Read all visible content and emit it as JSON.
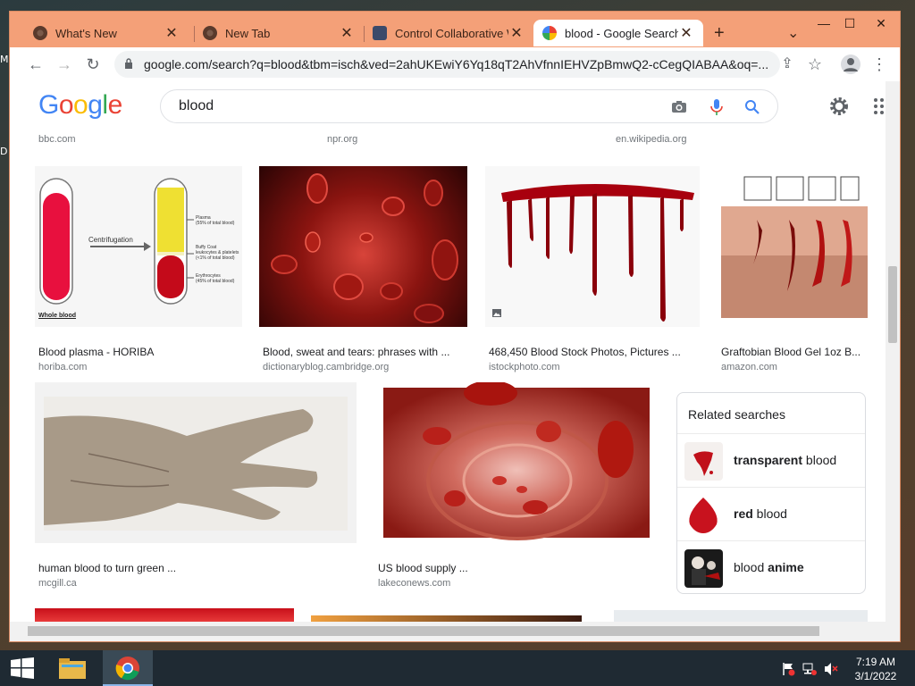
{
  "desktop": {
    "labels": [
      "M",
      "D"
    ]
  },
  "tabs": [
    {
      "label": "What's New",
      "close": "✕"
    },
    {
      "label": "New Tab",
      "close": "✕"
    },
    {
      "label": "Control Collaborative W",
      "close": "✕"
    },
    {
      "label": "blood - Google Search",
      "close": "✕"
    }
  ],
  "tab_new": "+",
  "tab_menu": "⌄",
  "window_controls": {
    "minimize": "—",
    "maximize": "☐",
    "close": "✕"
  },
  "toolbar": {
    "back": "←",
    "forward": "→",
    "reload": "↻",
    "url": "google.com/search?q=blood&tbm=isch&ved=2ahUKEwiY6Yq18qT2AhVfnnIEHVZpBmwQ2-cCegQIABAA&oq=...",
    "share_icon": "⇪",
    "star_icon": "☆",
    "menu_icon": "⋮"
  },
  "google": {
    "logo_letters": [
      "G",
      "o",
      "o",
      "g",
      "l",
      "e"
    ],
    "logo_colors": [
      "#4285f4",
      "#ea4335",
      "#fbbc05",
      "#4285f4",
      "#34a853",
      "#ea4335"
    ],
    "query": "blood"
  },
  "prev_row_sources": [
    "bbc.com",
    "npr.org",
    "en.wikipedia.org"
  ],
  "results_row1": [
    {
      "title": "Blood plasma - HORIBA",
      "source": "horiba.com"
    },
    {
      "title": "Blood, sweat and tears: phrases with ...",
      "source": "dictionaryblog.cambridge.org"
    },
    {
      "title": "468,450 Blood Stock Photos, Pictures ...",
      "source": "istockphoto.com"
    },
    {
      "title": "Graftobian Blood Gel 1oz B...",
      "source": "amazon.com"
    }
  ],
  "horiba_labels": {
    "centrifugation": "Centrifugation",
    "whole_blood": "Whole blood",
    "plasma": "Plasma",
    "plasma_pct": "(55% of total blood)",
    "buffy": "Buffy Coat",
    "buffy_sub": "leukocytes & platelets",
    "buffy_pct": "(<1% of total blood)",
    "ery": "Erythrocytes",
    "ery_pct": "(45% of total blood)"
  },
  "results_row2": [
    {
      "title": "human blood to turn green ...",
      "source": "mcgill.ca"
    },
    {
      "title": "US blood supply ...",
      "source": "lakeconews.com"
    }
  ],
  "related": {
    "heading": "Related searches",
    "items": [
      {
        "bold": "transparent",
        "rest": " blood",
        "bold_first": true
      },
      {
        "bold": "red",
        "rest": " blood",
        "bold_first": true
      },
      {
        "plain": "blood ",
        "bold": "anime",
        "bold_first": false
      }
    ]
  },
  "taskbar": {
    "time": "7:19 AM",
    "date": "3/1/2022"
  },
  "colors": {
    "chrome_frame": "#f4a078",
    "google_blue": "#4285f4",
    "blood_red": "#b3000c"
  }
}
